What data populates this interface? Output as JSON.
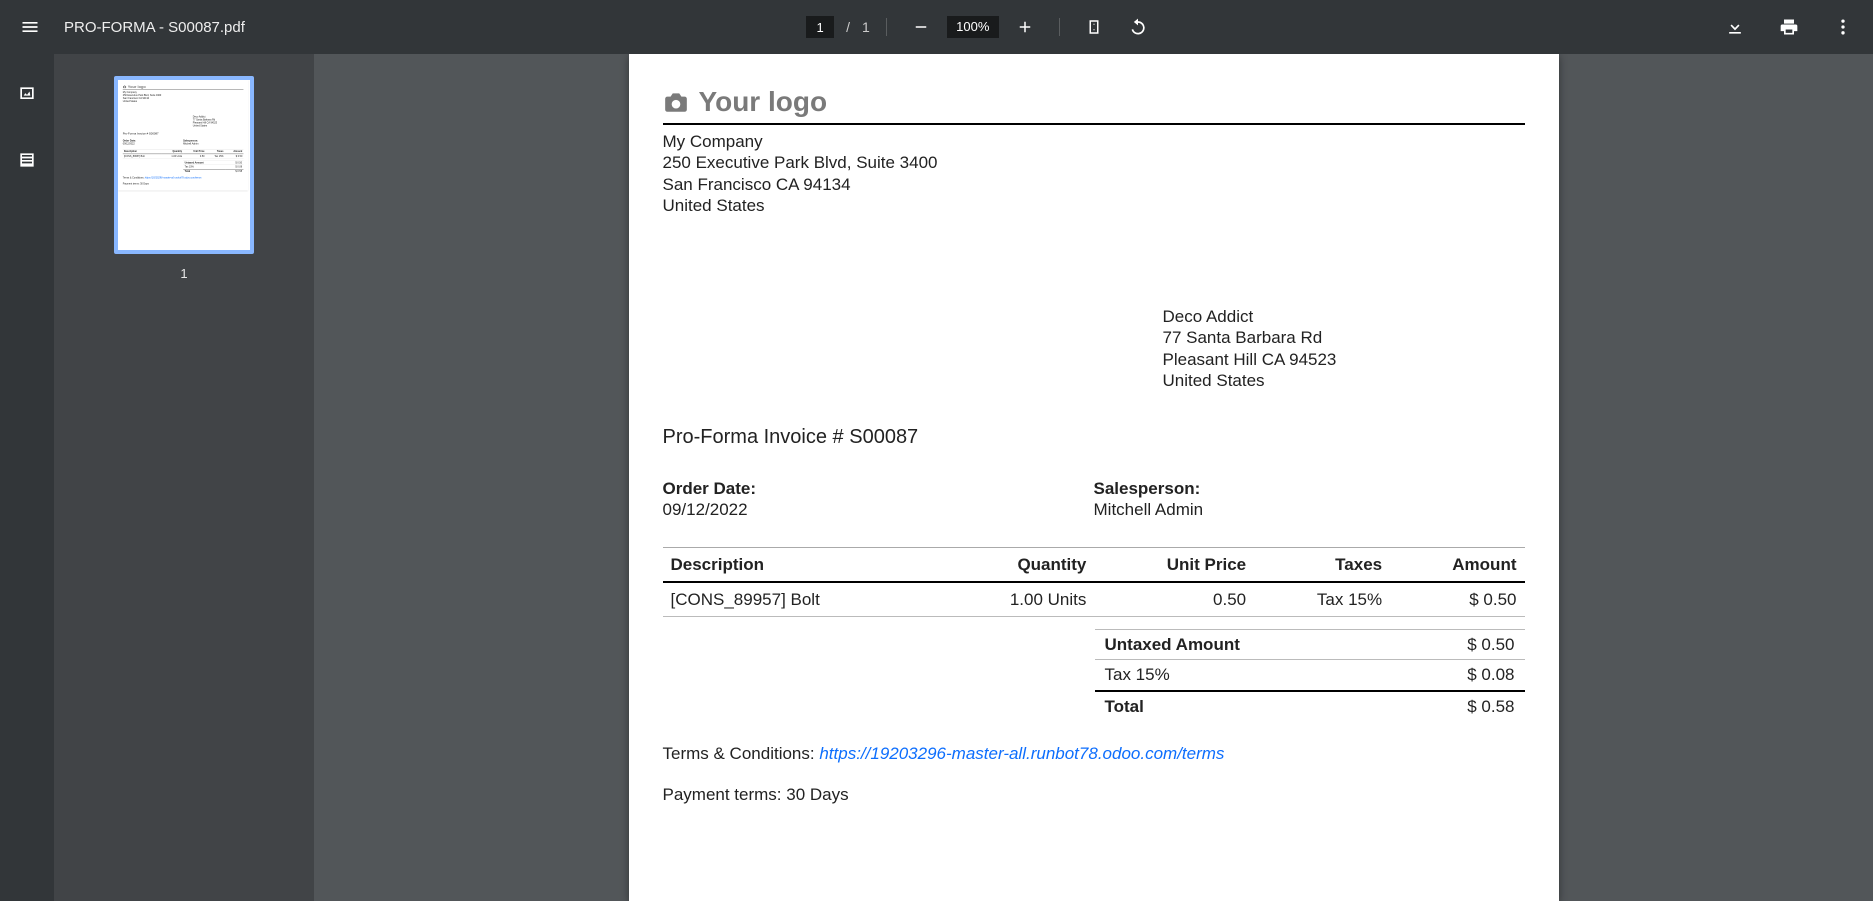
{
  "toolbar": {
    "filename": "PRO-FORMA - S00087.pdf",
    "current_page": "1",
    "total_pages": "1",
    "page_sep": "/",
    "zoom": "100%"
  },
  "sidebar": {
    "thumb_label": "1"
  },
  "doc": {
    "logo_text": "Your logo",
    "sender": {
      "name": "My Company",
      "street": "250 Executive Park Blvd, Suite 3400",
      "city_line": "San Francisco CA 94134",
      "country": "United States"
    },
    "recipient": {
      "name": "Deco Addict",
      "street": "77 Santa Barbara Rd",
      "city_line": "Pleasant Hill CA 94523",
      "country": "United States"
    },
    "invoice_title": "Pro-Forma Invoice # S00087",
    "meta": {
      "order_date_label": "Order Date:",
      "order_date": "09/12/2022",
      "salesperson_label": "Salesperson:",
      "salesperson": "Mitchell Admin"
    },
    "items": {
      "cols": {
        "desc": "Description",
        "qty": "Quantity",
        "unit": "Unit Price",
        "taxes": "Taxes",
        "amount": "Amount"
      },
      "rows": [
        {
          "desc": "[CONS_89957] Bolt",
          "qty": "1.00 Units",
          "unit": "0.50",
          "taxes": "Tax 15%",
          "amount": "$ 0.50"
        }
      ]
    },
    "totals": {
      "untaxed_label": "Untaxed Amount",
      "untaxed": "$ 0.50",
      "tax_label": "Tax 15%",
      "tax": "$ 0.08",
      "total_label": "Total",
      "total": "$ 0.58"
    },
    "terms_prefix": "Terms & Conditions: ",
    "terms_url": "https://19203296-master-all.runbot78.odoo.com/terms",
    "payment_terms": "Payment terms: 30 Days"
  }
}
